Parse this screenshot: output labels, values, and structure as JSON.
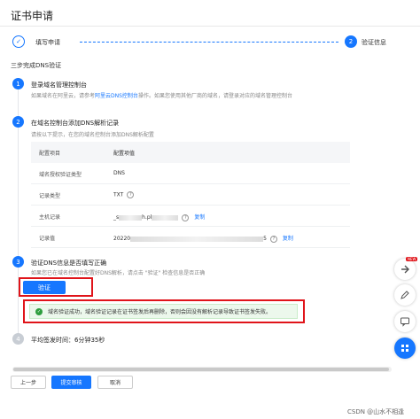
{
  "header": {
    "title": "证书申请"
  },
  "steps": [
    {
      "index": "✓",
      "label": "填写申请"
    },
    {
      "index": "2",
      "label": "验证信息"
    }
  ],
  "section_title": "三步完成DNS验证",
  "step1": {
    "number": "1",
    "title": "登录域名管理控制台",
    "desc_pre": "如果域名在阿里云，请参考",
    "desc_link": "阿里云DNS控制台",
    "desc_post": "操作。如果您使用其他厂商的域名，请登录对应的域名管理控制台"
  },
  "step2": {
    "number": "2",
    "title": "在域名控制台添加DNS解析记录",
    "desc": "请按以下提示，在您的域名控制台添加DNS解析配置"
  },
  "dns_table": {
    "header": {
      "key": "配置项目",
      "value": "配置项值"
    },
    "rows": [
      {
        "key": "域名授权验证类型",
        "value": "DNS",
        "help": false,
        "copy": ""
      },
      {
        "key": "记录类型",
        "value": "TXT",
        "help": true,
        "copy": ""
      },
      {
        "key": "主机记录",
        "value": "_s",
        "value_tail": "h.pl",
        "help": true,
        "copy": "复制"
      },
      {
        "key": "记录值",
        "value": "20220",
        "value_tail": "5",
        "help": true,
        "copy": "复制"
      }
    ]
  },
  "step3": {
    "number": "3",
    "title": "验证DNS信息是否填写正确",
    "desc": "如果您已在域名控制台配置好DNS解析，请点击 \"验证\" 检查信息是否正确",
    "verify_label": "验证",
    "success_message": "域名验证成功，域名验证记录在证书签发后再删除，否则会因没有解析记录导致证书签发失败。"
  },
  "step4": {
    "number": "4",
    "title": "平均签发时间：6分钟35秒"
  },
  "footer": {
    "prev_label": "上一步",
    "submit_label": "提交审核",
    "cancel_label": "取消"
  },
  "float_buttons": [
    {
      "icon": "new-icon",
      "badge": "NEW"
    },
    {
      "icon": "edit-icon"
    },
    {
      "icon": "chat-icon"
    },
    {
      "icon": "grid-apps-icon"
    }
  ],
  "watermark": "CSDN @山水不相逢",
  "colors": {
    "accent": "#1677ff",
    "success": "#2e9e3e",
    "highlight": "#e0141a"
  }
}
